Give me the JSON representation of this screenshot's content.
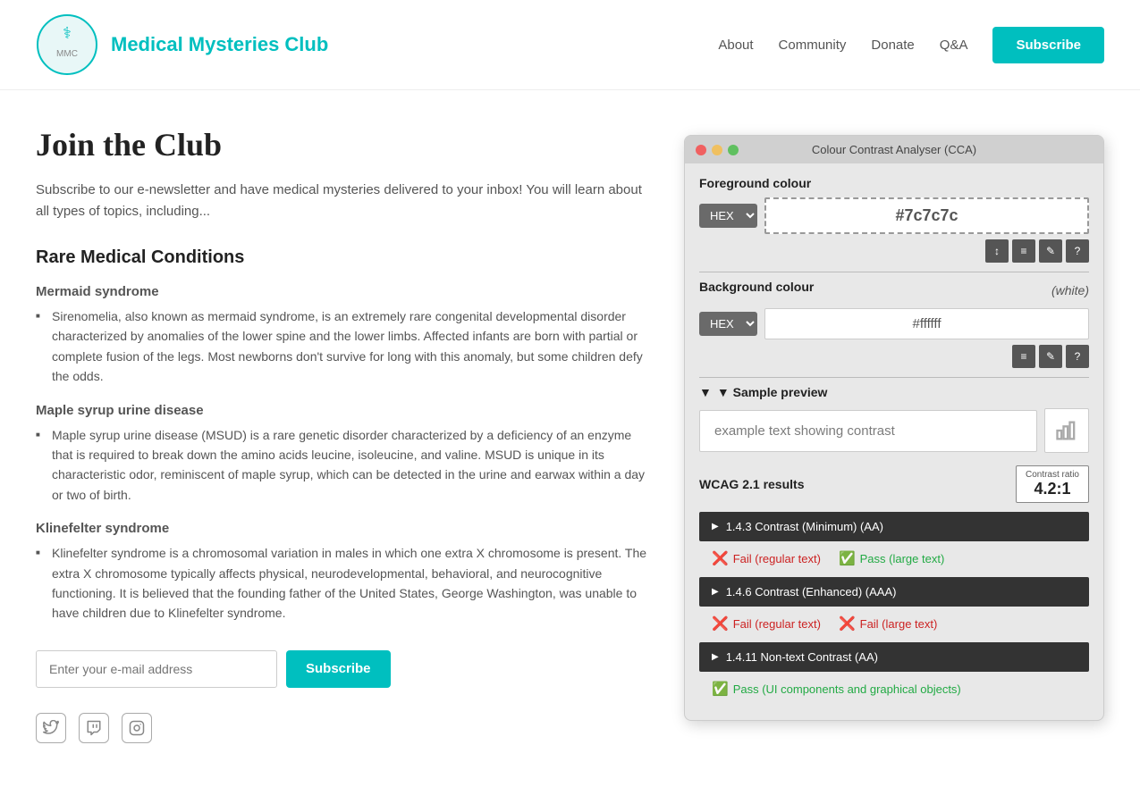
{
  "header": {
    "logo_alt": "Medical Mysteries Club logo",
    "title": "Medical Mysteries Club",
    "nav": {
      "about": "About",
      "community": "Community",
      "donate": "Donate",
      "qa": "Q&A",
      "subscribe": "Subscribe"
    }
  },
  "main": {
    "page_title": "Join the Club",
    "intro": "Subscribe to our e-newsletter and have medical mysteries delivered to your inbox! You will learn about all types of topics, including...",
    "section_heading": "Rare Medical Conditions",
    "conditions": [
      {
        "name": "Mermaid syndrome",
        "items": [
          "Sirenomelia, also known as mermaid syndrome, is an extremely rare congenital developmental disorder characterized by anomalies of the lower spine and the lower limbs. Affected infants are born with partial or complete fusion of the legs. Most newborns don't survive for long with this anomaly, but some children defy the odds."
        ]
      },
      {
        "name": "Maple syrup urine disease",
        "items": [
          "Maple syrup urine disease (MSUD) is a rare genetic disorder characterized by a deficiency of an enzyme that is required to break down the amino acids leucine, isoleucine, and valine. MSUD is unique in its characteristic odor, reminiscent of maple syrup, which can be detected in the urine and earwax within a day or two of birth."
        ]
      },
      {
        "name": "Klinefelter syndrome",
        "items": [
          "Klinefelter syndrome is a chromosomal variation in males in which one extra X chromosome is present. The extra X chromosome typically affects physical, neurodevelopmental, behavioral, and neurocognitive functioning. It is believed that the founding father of the United States, George Washington, was unable to have children due to Klinefelter syndrome."
        ]
      }
    ],
    "email_placeholder": "Enter your e-mail address",
    "subscribe_label": "Subscribe"
  },
  "cca": {
    "titlebar": "Colour Contrast Analyser (CCA)",
    "foreground_label": "Foreground colour",
    "fg_format": "HEX",
    "fg_value": "#7c7c7c",
    "fg_icons": [
      "↕",
      "≡",
      "✎",
      "?"
    ],
    "background_label": "Background colour",
    "bg_white_label": "(white)",
    "bg_format": "HEX",
    "bg_value": "#ffffff",
    "bg_icons": [
      "≡",
      "✎",
      "?"
    ],
    "sample_preview_label": "▼ Sample preview",
    "sample_text": "example text showing contrast",
    "wcag_label": "WCAG 2.1 results",
    "contrast_ratio_title": "Contrast ratio",
    "contrast_ratio_value": "4.2:1",
    "results": [
      {
        "id": "1.4.3 Contrast (Minimum) (AA)",
        "pass_regular": false,
        "pass_large": true,
        "regular_label": "Fail (regular text)",
        "large_label": "Pass (large text)"
      },
      {
        "id": "1.4.6 Contrast (Enhanced) (AAA)",
        "pass_regular": false,
        "pass_large": false,
        "regular_label": "Fail (regular text)",
        "large_label": "Fail (large text)"
      },
      {
        "id": "1.4.11 Non-text Contrast (AA)",
        "pass_ui": true,
        "ui_label": "Pass (UI components and graphical objects)"
      }
    ]
  },
  "social": {
    "icons": [
      "twitter",
      "twitch",
      "instagram"
    ]
  }
}
